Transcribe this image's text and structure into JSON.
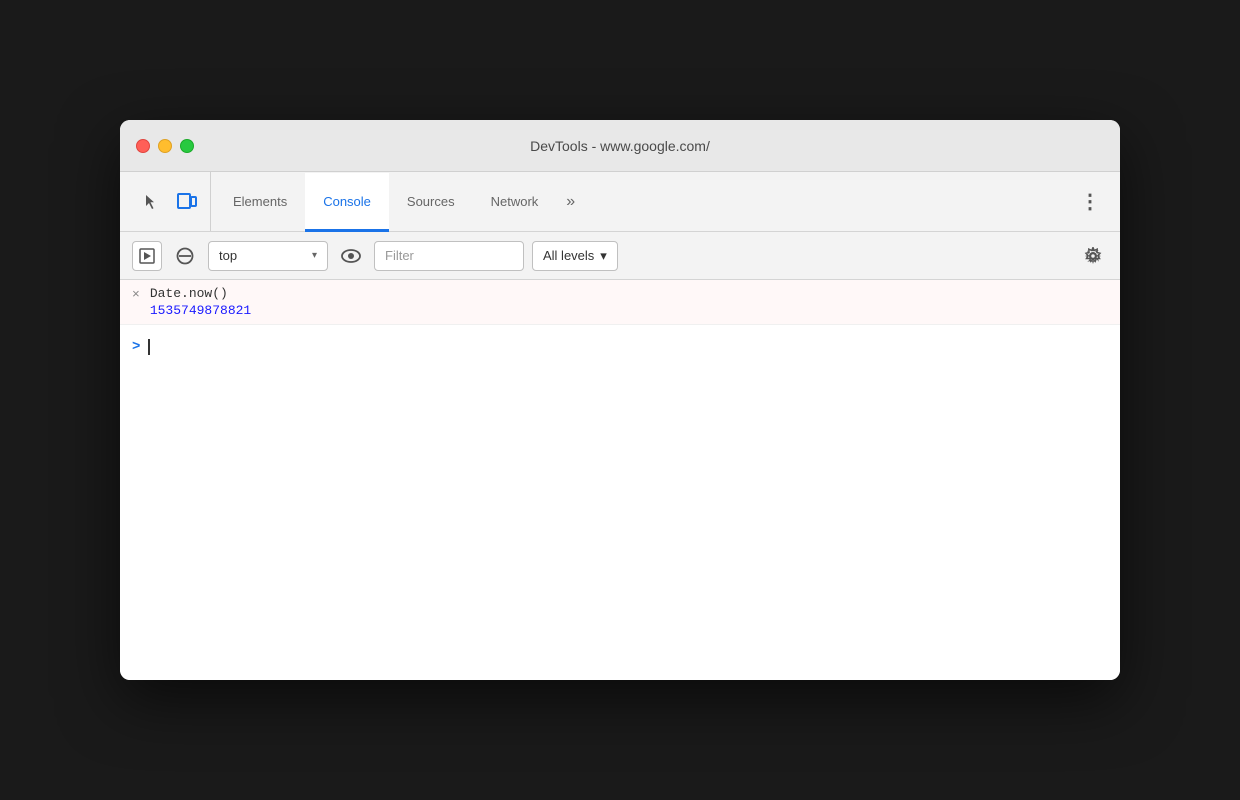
{
  "window": {
    "title": "DevTools - www.google.com/",
    "traffic_lights": {
      "close_label": "close",
      "minimize_label": "minimize",
      "maximize_label": "maximize"
    }
  },
  "tabs": {
    "items": [
      {
        "id": "elements",
        "label": "Elements",
        "active": false
      },
      {
        "id": "console",
        "label": "Console",
        "active": true
      },
      {
        "id": "sources",
        "label": "Sources",
        "active": false
      },
      {
        "id": "network",
        "label": "Network",
        "active": false
      }
    ],
    "more_label": "»",
    "menu_label": "⋮"
  },
  "toolbar": {
    "context_value": "top",
    "filter_placeholder": "Filter",
    "levels_label": "All levels"
  },
  "console": {
    "entry": {
      "icon": "×",
      "command": "Date.now()",
      "result": "1535749878821"
    },
    "prompt_symbol": ">",
    "colors": {
      "result": "#1a1aff",
      "prompt": "#1a73e8",
      "command": "#333333",
      "entry_bg": "#fff8f8"
    }
  }
}
